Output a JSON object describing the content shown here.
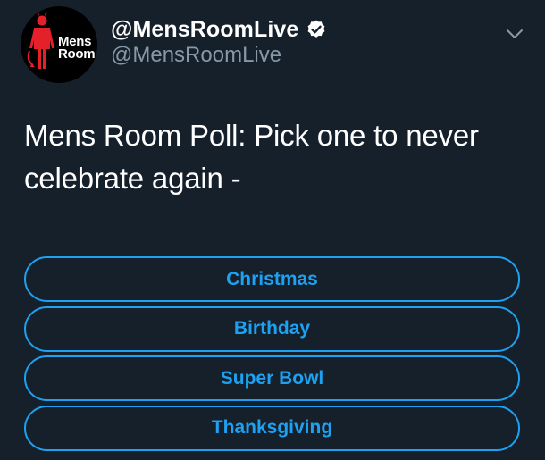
{
  "account": {
    "display_name": "@MensRoomLive",
    "handle": "@MensRoomLive",
    "verified": true,
    "avatar_logo_line1": "Mens",
    "avatar_logo_line2": "Room"
  },
  "tweet": {
    "text": "Mens Room Poll: Pick one to never celebrate again -"
  },
  "poll": {
    "options": [
      {
        "label": "Christmas"
      },
      {
        "label": "Birthday"
      },
      {
        "label": "Super Bowl"
      },
      {
        "label": "Thanksgiving"
      }
    ]
  },
  "colors": {
    "background": "#15202b",
    "accent": "#1da1f2",
    "secondary_text": "#8899a6",
    "logo_red": "#e4212b"
  },
  "icons": {
    "verified": "verified-badge-icon",
    "menu": "chevron-down-icon"
  }
}
